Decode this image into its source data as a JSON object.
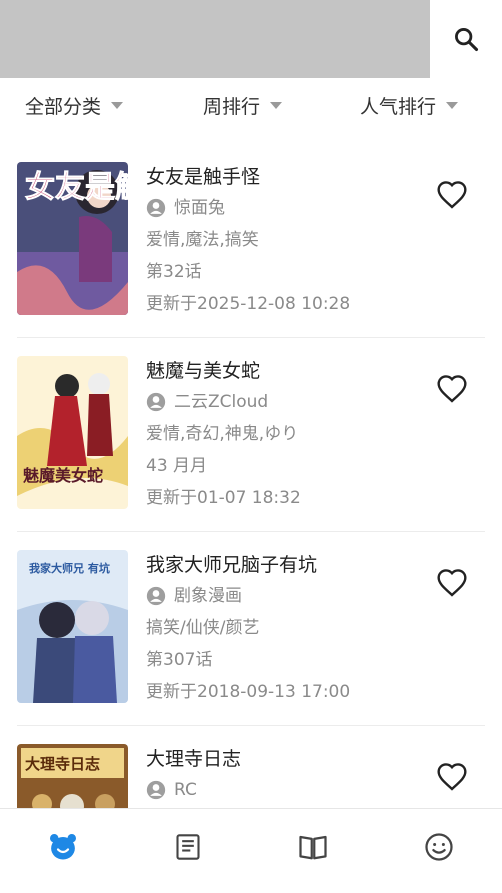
{
  "filters": {
    "category": "全部分类",
    "period": "周排行",
    "sort": "人气排行"
  },
  "items": [
    {
      "title": "女友是触手怪",
      "author": "惊面兔",
      "tags": "爱情,魔法,搞笑",
      "chapter": "第32话",
      "updated": "更新于2025-12-08 10:28"
    },
    {
      "title": "魅魔与美女蛇",
      "author": "二云ZCloud",
      "tags": "爱情,奇幻,神鬼,ゆり",
      "chapter": "43 月月",
      "updated": "更新于01-07 18:32"
    },
    {
      "title": "我家大师兄脑子有坑",
      "author": "剧象漫画",
      "tags": "搞笑/仙侠/颜艺",
      "chapter": "第307话",
      "updated": "更新于2018-09-13 17:00"
    },
    {
      "title": "大理寺日志",
      "author": "RC",
      "tags": "",
      "chapter": "",
      "updated": ""
    }
  ],
  "covers": {
    "0": {
      "art_text": "女友是触手怪"
    },
    "1": {
      "art_text": "魅魔美女蛇"
    },
    "2": {
      "art_text": "我家大师兄 有坑"
    },
    "3": {
      "art_text": "大理寺日志"
    }
  },
  "icons": {
    "search": "search-icon",
    "favorite": "heart-outline-icon",
    "home": "bear-icon",
    "list": "article-icon",
    "read": "book-icon",
    "profile": "smiley-icon"
  },
  "colors": {
    "accent": "#1e88e5",
    "topbar_gray": "#c4c4c4",
    "muted_text": "#8a8a8a"
  }
}
